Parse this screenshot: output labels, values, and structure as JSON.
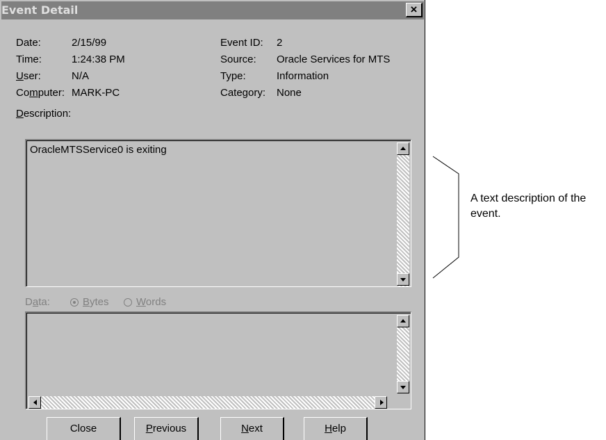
{
  "window": {
    "title": "Event Detail",
    "close_glyph": "×"
  },
  "fields": {
    "date_label": "Date:",
    "date_value": "2/15/99",
    "time_label": "Time:",
    "time_value": "1:24:38 PM",
    "user_label_ul": "U",
    "user_label_rest": "ser:",
    "user_value": "N/A",
    "computer_label_pre": "Co",
    "computer_label_ul": "m",
    "computer_label_rest": "puter:",
    "computer_value": "MARK-PC",
    "eventid_label": "Event ID:",
    "eventid_value": "2",
    "source_label": "Source:",
    "source_value": "Oracle Services for MTS",
    "type_label": "Type:",
    "type_value": "Information",
    "category_label": "Category:",
    "category_value": "None"
  },
  "description": {
    "label_ul": "D",
    "label_rest": "escription:",
    "text": "OracleMTSService0 is exiting"
  },
  "data_section": {
    "label_pre": "D",
    "label_ul": "a",
    "label_rest": "ta:",
    "bytes_ul": "B",
    "bytes_rest": "ytes",
    "words_ul": "W",
    "words_rest": "ords",
    "selected": "Bytes"
  },
  "buttons": {
    "close": "Close",
    "previous_ul": "P",
    "previous_rest": "revious",
    "next_ul": "N",
    "next_rest": "ext",
    "help_ul": "H",
    "help_rest": "elp"
  },
  "callout": {
    "text": "A text description of the event."
  },
  "icons": [
    "close-icon",
    "scroll-up-icon",
    "scroll-down-icon",
    "scroll-left-icon",
    "scroll-right-icon",
    "radio-icon"
  ]
}
